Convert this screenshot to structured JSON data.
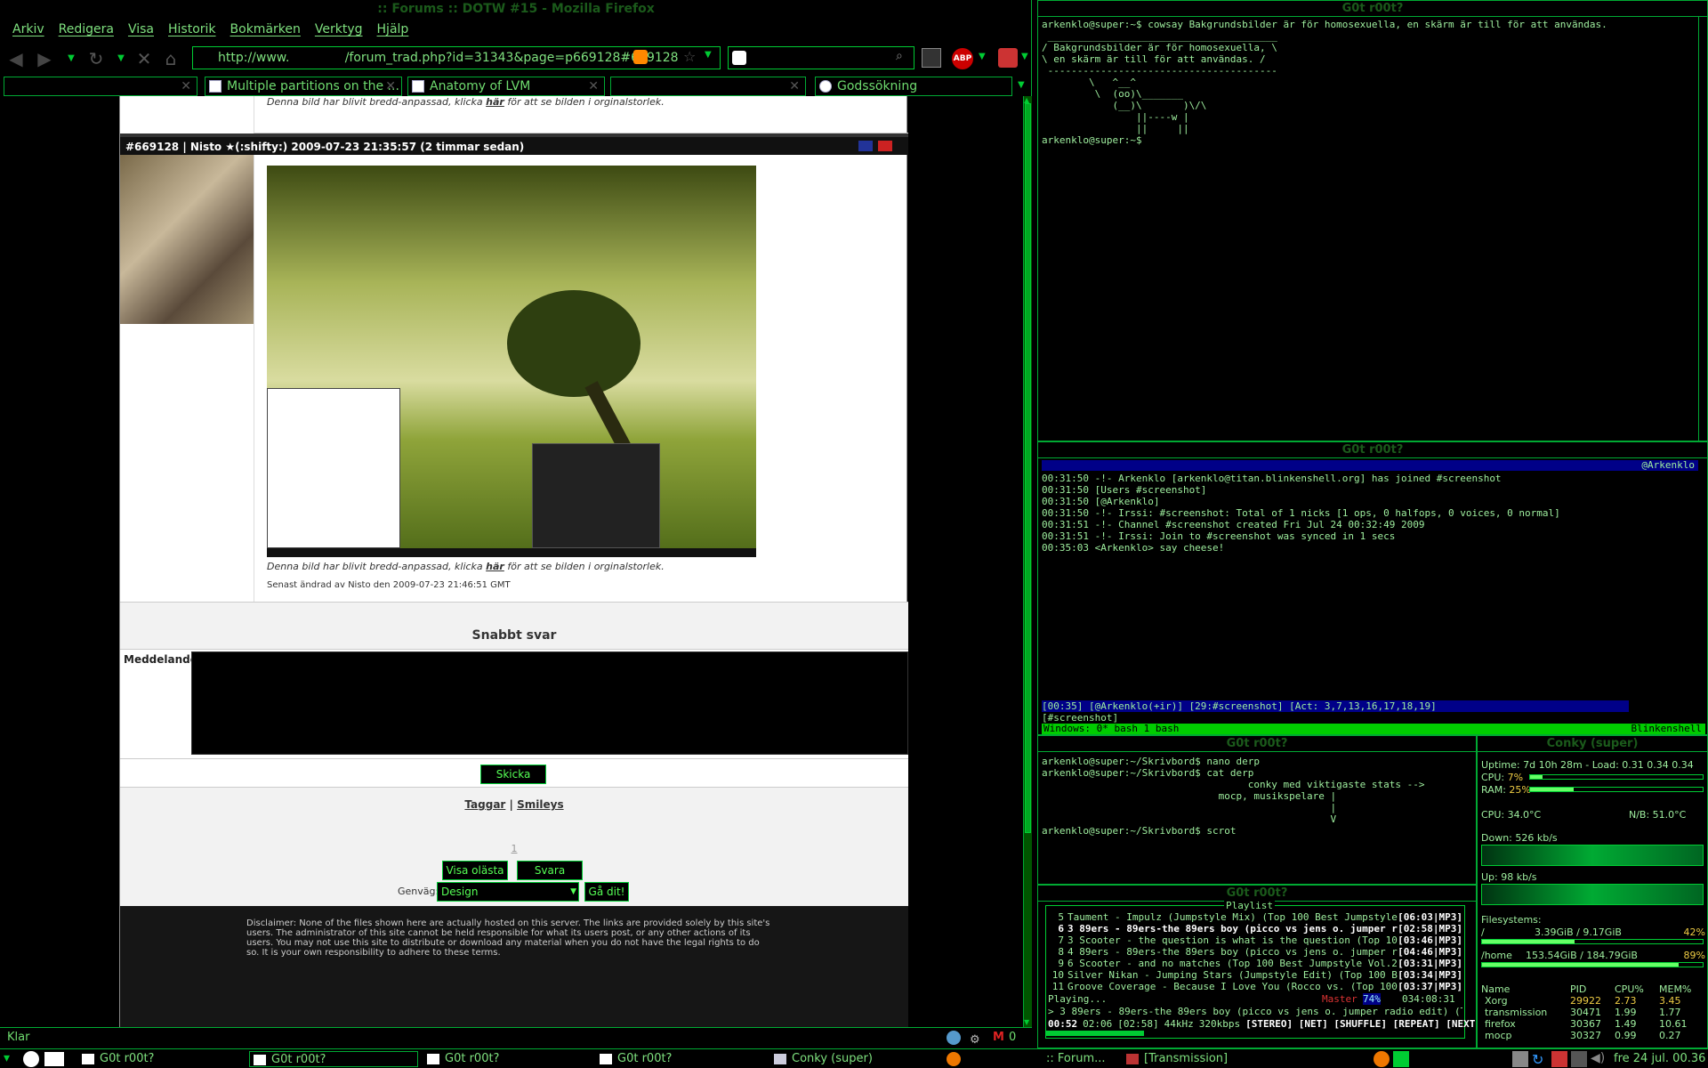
{
  "firefox": {
    "title": ":: Forums :: DOTW #15 - Mozilla Firefox",
    "menu": [
      "Arkiv",
      "Redigera",
      "Visa",
      "Historik",
      "Bokmärken",
      "Verktyg",
      "Hjälp"
    ],
    "url": "http://www.              /forum_trad.php?id=31343&page=p669128#669128",
    "tabs": [
      "Multiple partitions on the ...",
      "Anatomy of LVM",
      "Godssökning"
    ],
    "status": "Klar",
    "gmail_count": "0"
  },
  "forum": {
    "prev_caption_text": "Denna bild har blivit bredd-anpassad, klicka",
    "caption_link": "här",
    "caption_tail": "för att se bilden i orginalstorlek.",
    "post_header": "#669128 | Nisto ★(:shifty:) 2009-07-23 21:35:57 (2 timmar sedan)",
    "caption_text": "Denna bild har blivit bredd-anpassad, klicka",
    "edited": "Senast ändrad av Nisto den 2009-07-23 21:46:51 GMT",
    "quick_reply": "Snabbt svar",
    "message_label": "Meddelande",
    "send_button": "Skicka",
    "tags": "Taggar",
    "separator": "|",
    "smileys": "Smileys",
    "page_number": "1",
    "show_unread": "Visa olästa",
    "reply": "Svara",
    "shortcut_label": "Genväg:",
    "shortcut_value": "Design",
    "go_button": "Gå dit!",
    "disclaimer": "Disclaimer: None of the files shown here are actually hosted on this server. The links are provided solely by this site's users. The administrator of this site                                          cannot be held responsible for what its users post, or any other actions of its users. You may not use this site to distribute or download any material when you do not have the legal rights to do so. It is your own responsibility to adhere to these terms."
  },
  "term1": {
    "title": "G0t r00t?",
    "lines": [
      "arkenklo@super:~$ cowsay Bakgrundsbilder är för homosexuella, en skärm är till för att användas.",
      " _______________________________________",
      "/ Bakgrundsbilder är för homosexuella, \\",
      "\\ en skärm är till för att användas. /",
      " ---------------------------------------",
      "        \\   ^__^",
      "         \\  (oo)\\_______",
      "            (__)\\       )\\/\\",
      "                ||----w |",
      "                ||     ||",
      "arkenklo@super:~$ "
    ]
  },
  "irssi": {
    "title": "G0t r00t?",
    "topic_right": "@Arkenklo",
    "lines": [
      "00:31:50 -!- Arkenklo [arkenklo@titan.blinkenshell.org] has joined #screenshot",
      "00:31:50 [Users #screenshot]",
      "00:31:50 [@Arkenklo]",
      "00:31:50 -!- Irssi: #screenshot: Total of 1 nicks [1 ops, 0 halfops, 0 voices, 0 normal]",
      "00:31:51 -!- Channel #screenshot created Fri Jul 24 00:32:49 2009",
      "00:31:51 -!- Irssi: Join to #screenshot was synced in 1 secs",
      "00:35:03 <Arkenklo> say cheese!"
    ],
    "statusline": "[00:35] [@Arkenklo(+ir)] [29:#screenshot] [Act: 3,7,13,16,17,18,19]",
    "prompt": "[#screenshot] ",
    "windows_bar": "Windows: 0* bash  1 bash",
    "windows_right": "Blinkenshell"
  },
  "term3": {
    "title": "G0t r00t?",
    "lines": [
      "arkenklo@super:~/Skrivbord$ nano derp",
      "arkenklo@super:~/Skrivbord$ cat derp",
      "                                   conky med viktigaste stats -->",
      "",
      "",
      "",
      "",
      "                              mocp, musikspelare |",
      "                                                 |",
      "                                                 V",
      "arkenklo@super:~/Skrivbord$ scrot"
    ]
  },
  "mocp": {
    "title": "G0t r00t?",
    "playlist_label": "Playlist",
    "tracks": [
      {
        "n": "5",
        "t": "Taument - Impulz (Jumpstyle Mix) (Top 100 Best Jumpstyle Vol.2",
        "d": "[06:03|MP3]"
      },
      {
        "n": "6",
        "t": "3 89ers - 89ers-the 89ers boy (picco vs jens o. jumper radio e",
        "d": "[02:58|MP3]"
      },
      {
        "n": "7",
        "t": "3 Scooter - the question is what is the question (Top 100 Best",
        "d": "[03:46|MP3]"
      },
      {
        "n": "8",
        "t": "4 89ers - 89ers-the 89ers boy (picco vs jens o. jumper remix)",
        "d": "[04:46|MP3]"
      },
      {
        "n": "9",
        "t": "6 Scooter - and no matches (Top 100 Best Jumpstyle Vol.2)",
        "d": "[03:31|MP3]"
      },
      {
        "n": "10",
        "t": "Silver Nikan - Jumping Stars (Jumpstyle Edit) (Top 100 Best Ju",
        "d": "[03:34|MP3]"
      },
      {
        "n": "11",
        "t": "Groove Coverage - Because I Love You (Rocco vs. (Top 100 Best",
        "d": "[03:37|MP3]"
      }
    ],
    "master_label": "Master",
    "master_value": "74%",
    "total_time": "034:08:31",
    "playing_label": "Playing...",
    "now_playing": "> 3 89ers - 89ers-the 89ers boy (picco vs jens o. jumper radio edit) (Top 10",
    "time_elapsed": "00:52",
    "time_remaining": "02:06",
    "time_total": "[02:58]",
    "freq": "44kHz",
    "bitrate": "320kbps",
    "flags": "[STEREO] [NET] [SHUFFLE] [REPEAT] [NEXT]"
  },
  "conky": {
    "title": "Conky (super)",
    "uptime": "Uptime: 7d 10h 28m - Load: 0.31 0.34 0.34",
    "cpu_label": "CPU:",
    "cpu_value": "7%",
    "cpu_fraction": 0.07,
    "ram_label": "RAM:",
    "ram_value": "25%",
    "ram_fraction": 0.25,
    "cpu_temp": "CPU: 34.0°C",
    "nb_temp": "N/B: 51.0°C",
    "down": "Down: 526 kb/s",
    "up": "Up: 98 kb/s",
    "fs_label": "Filesystems:",
    "fs": [
      {
        "mount": "/",
        "usage": "3.39GiB / 9.17GiB",
        "pct": "42%",
        "fraction": 0.42
      },
      {
        "mount": "/home",
        "usage": "153.54GiB / 184.79GiB",
        "pct": "89%",
        "fraction": 0.89
      }
    ],
    "proc_headers": [
      "Name",
      "PID",
      "CPU%",
      "MEM%"
    ],
    "procs": [
      [
        "Xorg",
        "29922",
        "2.73",
        "3.45"
      ],
      [
        "transmission",
        "30471",
        "1.99",
        "1.77"
      ],
      [
        "firefox",
        "30367",
        "1.49",
        "10.61"
      ],
      [
        "mocp",
        "30327",
        "0.99",
        "0.27"
      ]
    ]
  },
  "taskbar": {
    "tasks": [
      "G0t r00t?",
      "G0t r00t?",
      "G0t r00t?",
      "G0t r00t?",
      "Conky (super)",
      ":: Forum...",
      "[Transmission]"
    ],
    "clock": "fre 24 jul. 00.36"
  },
  "colors": {
    "accent": "#00cc33",
    "bg": "#000000",
    "irssi_bar": "#000088"
  }
}
